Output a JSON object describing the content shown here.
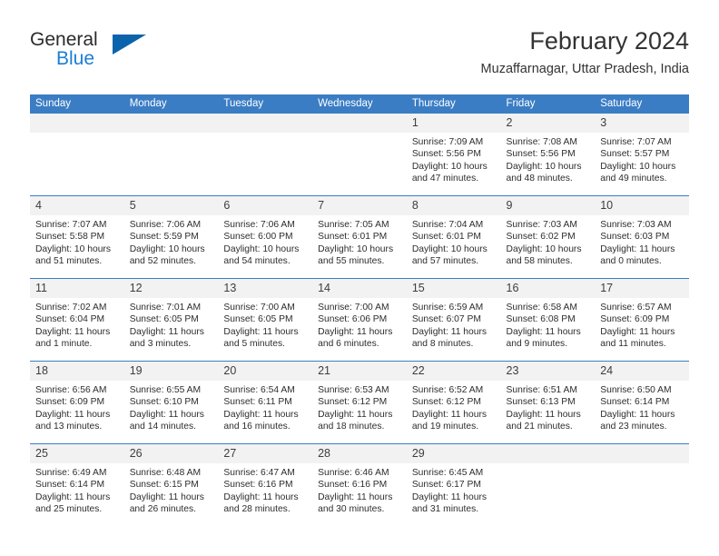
{
  "brand": {
    "name_top": "General",
    "name_bottom": "Blue",
    "accent_color": "#1a7ed6",
    "triangle_color": "#0b63ab"
  },
  "header": {
    "title": "February 2024",
    "subtitle": "Muzaffarnagar, Uttar Pradesh, India"
  },
  "calendar": {
    "header_bg": "#3b7dc4",
    "daynum_bg": "#f2f2f2",
    "weekday_headers": [
      "Sunday",
      "Monday",
      "Tuesday",
      "Wednesday",
      "Thursday",
      "Friday",
      "Saturday"
    ],
    "weeks": [
      [
        {
          "day": "",
          "empty": true
        },
        {
          "day": "",
          "empty": true
        },
        {
          "day": "",
          "empty": true
        },
        {
          "day": "",
          "empty": true
        },
        {
          "day": "1",
          "sunrise": "Sunrise: 7:09 AM",
          "sunset": "Sunset: 5:56 PM",
          "daylight": "Daylight: 10 hours and 47 minutes."
        },
        {
          "day": "2",
          "sunrise": "Sunrise: 7:08 AM",
          "sunset": "Sunset: 5:56 PM",
          "daylight": "Daylight: 10 hours and 48 minutes."
        },
        {
          "day": "3",
          "sunrise": "Sunrise: 7:07 AM",
          "sunset": "Sunset: 5:57 PM",
          "daylight": "Daylight: 10 hours and 49 minutes."
        }
      ],
      [
        {
          "day": "4",
          "sunrise": "Sunrise: 7:07 AM",
          "sunset": "Sunset: 5:58 PM",
          "daylight": "Daylight: 10 hours and 51 minutes."
        },
        {
          "day": "5",
          "sunrise": "Sunrise: 7:06 AM",
          "sunset": "Sunset: 5:59 PM",
          "daylight": "Daylight: 10 hours and 52 minutes."
        },
        {
          "day": "6",
          "sunrise": "Sunrise: 7:06 AM",
          "sunset": "Sunset: 6:00 PM",
          "daylight": "Daylight: 10 hours and 54 minutes."
        },
        {
          "day": "7",
          "sunrise": "Sunrise: 7:05 AM",
          "sunset": "Sunset: 6:01 PM",
          "daylight": "Daylight: 10 hours and 55 minutes."
        },
        {
          "day": "8",
          "sunrise": "Sunrise: 7:04 AM",
          "sunset": "Sunset: 6:01 PM",
          "daylight": "Daylight: 10 hours and 57 minutes."
        },
        {
          "day": "9",
          "sunrise": "Sunrise: 7:03 AM",
          "sunset": "Sunset: 6:02 PM",
          "daylight": "Daylight: 10 hours and 58 minutes."
        },
        {
          "day": "10",
          "sunrise": "Sunrise: 7:03 AM",
          "sunset": "Sunset: 6:03 PM",
          "daylight": "Daylight: 11 hours and 0 minutes."
        }
      ],
      [
        {
          "day": "11",
          "sunrise": "Sunrise: 7:02 AM",
          "sunset": "Sunset: 6:04 PM",
          "daylight": "Daylight: 11 hours and 1 minute."
        },
        {
          "day": "12",
          "sunrise": "Sunrise: 7:01 AM",
          "sunset": "Sunset: 6:05 PM",
          "daylight": "Daylight: 11 hours and 3 minutes."
        },
        {
          "day": "13",
          "sunrise": "Sunrise: 7:00 AM",
          "sunset": "Sunset: 6:05 PM",
          "daylight": "Daylight: 11 hours and 5 minutes."
        },
        {
          "day": "14",
          "sunrise": "Sunrise: 7:00 AM",
          "sunset": "Sunset: 6:06 PM",
          "daylight": "Daylight: 11 hours and 6 minutes."
        },
        {
          "day": "15",
          "sunrise": "Sunrise: 6:59 AM",
          "sunset": "Sunset: 6:07 PM",
          "daylight": "Daylight: 11 hours and 8 minutes."
        },
        {
          "day": "16",
          "sunrise": "Sunrise: 6:58 AM",
          "sunset": "Sunset: 6:08 PM",
          "daylight": "Daylight: 11 hours and 9 minutes."
        },
        {
          "day": "17",
          "sunrise": "Sunrise: 6:57 AM",
          "sunset": "Sunset: 6:09 PM",
          "daylight": "Daylight: 11 hours and 11 minutes."
        }
      ],
      [
        {
          "day": "18",
          "sunrise": "Sunrise: 6:56 AM",
          "sunset": "Sunset: 6:09 PM",
          "daylight": "Daylight: 11 hours and 13 minutes."
        },
        {
          "day": "19",
          "sunrise": "Sunrise: 6:55 AM",
          "sunset": "Sunset: 6:10 PM",
          "daylight": "Daylight: 11 hours and 14 minutes."
        },
        {
          "day": "20",
          "sunrise": "Sunrise: 6:54 AM",
          "sunset": "Sunset: 6:11 PM",
          "daylight": "Daylight: 11 hours and 16 minutes."
        },
        {
          "day": "21",
          "sunrise": "Sunrise: 6:53 AM",
          "sunset": "Sunset: 6:12 PM",
          "daylight": "Daylight: 11 hours and 18 minutes."
        },
        {
          "day": "22",
          "sunrise": "Sunrise: 6:52 AM",
          "sunset": "Sunset: 6:12 PM",
          "daylight": "Daylight: 11 hours and 19 minutes."
        },
        {
          "day": "23",
          "sunrise": "Sunrise: 6:51 AM",
          "sunset": "Sunset: 6:13 PM",
          "daylight": "Daylight: 11 hours and 21 minutes."
        },
        {
          "day": "24",
          "sunrise": "Sunrise: 6:50 AM",
          "sunset": "Sunset: 6:14 PM",
          "daylight": "Daylight: 11 hours and 23 minutes."
        }
      ],
      [
        {
          "day": "25",
          "sunrise": "Sunrise: 6:49 AM",
          "sunset": "Sunset: 6:14 PM",
          "daylight": "Daylight: 11 hours and 25 minutes."
        },
        {
          "day": "26",
          "sunrise": "Sunrise: 6:48 AM",
          "sunset": "Sunset: 6:15 PM",
          "daylight": "Daylight: 11 hours and 26 minutes."
        },
        {
          "day": "27",
          "sunrise": "Sunrise: 6:47 AM",
          "sunset": "Sunset: 6:16 PM",
          "daylight": "Daylight: 11 hours and 28 minutes."
        },
        {
          "day": "28",
          "sunrise": "Sunrise: 6:46 AM",
          "sunset": "Sunset: 6:16 PM",
          "daylight": "Daylight: 11 hours and 30 minutes."
        },
        {
          "day": "29",
          "sunrise": "Sunrise: 6:45 AM",
          "sunset": "Sunset: 6:17 PM",
          "daylight": "Daylight: 11 hours and 31 minutes."
        },
        {
          "day": "",
          "empty": true
        },
        {
          "day": "",
          "empty": true
        }
      ]
    ]
  }
}
